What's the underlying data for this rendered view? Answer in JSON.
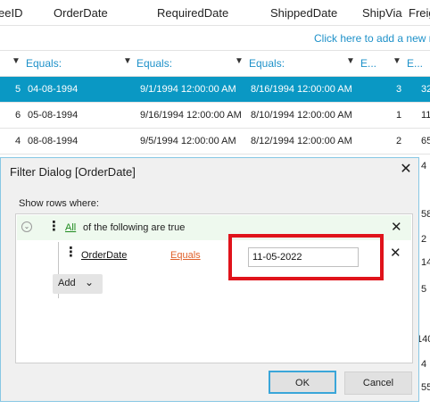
{
  "grid": {
    "columns": [
      "eeID",
      "OrderDate",
      "RequiredDate",
      "ShippedDate",
      "ShipVia",
      "Freig"
    ],
    "add_row_text": "Click here to add a new r",
    "filter_labels": [
      "Equals:",
      "Equals:",
      "Equals:",
      "E...",
      "E..."
    ],
    "rows": [
      {
        "id": "5",
        "order": "04-08-1994",
        "required": "9/1/1994 12:00:00 AM",
        "shipped": "8/16/1994 12:00:00 AM",
        "via": "3",
        "freight": "32"
      },
      {
        "id": "6",
        "order": "05-08-1994",
        "required": "9/16/1994 12:00:00 AM",
        "shipped": "8/10/1994 12:00:00 AM",
        "via": "1",
        "freight": "11"
      },
      {
        "id": "4",
        "order": "08-08-1994",
        "required": "9/5/1994 12:00:00 AM",
        "shipped": "8/12/1994 12:00:00 AM",
        "via": "2",
        "freight": "65"
      }
    ],
    "right_edge_values": [
      "4",
      "58",
      "2",
      "14",
      "5",
      "140",
      "4",
      "55"
    ]
  },
  "dialog": {
    "title": "Filter Dialog [OrderDate]",
    "show_rows_label": "Show rows where:",
    "group": {
      "all_link": "All",
      "text": "of the following are true"
    },
    "condition": {
      "field": "OrderDate",
      "operator": "Equals",
      "value": "11-05-2022"
    },
    "add_label": "Add",
    "ok_label": "OK",
    "cancel_label": "Cancel"
  },
  "colors": {
    "selected_row": "#0a98c4",
    "link_blue": "#1e91c9",
    "highlight_red": "#e0131b",
    "operator_orange": "#e0612a"
  },
  "icons": [
    "filter-icon",
    "close-icon",
    "drag-handle-icon",
    "chevron-down-icon",
    "collapse-icon"
  ]
}
